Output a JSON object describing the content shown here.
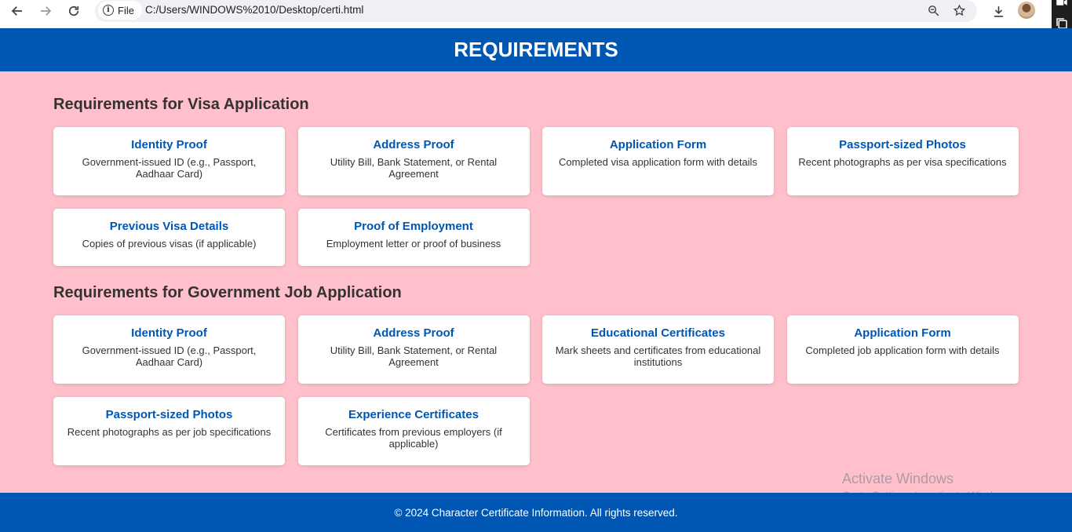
{
  "browser": {
    "url": "C:/Users/WINDOWS%2010/Desktop/certi.html",
    "scheme_label": "File",
    "icons": [
      "back-arrow-icon",
      "forward-arrow-icon",
      "reload-icon",
      "info-icon",
      "zoom-icon",
      "star-icon",
      "download-icon",
      "profile-avatar"
    ]
  },
  "header": {
    "title": "REQUIREMENTS"
  },
  "sections": [
    {
      "title": "Requirements for Visa Application",
      "cards": [
        {
          "title": "Identity Proof",
          "desc": "Government-issued ID (e.g., Passport, Aadhaar Card)"
        },
        {
          "title": "Address Proof",
          "desc": "Utility Bill, Bank Statement, or Rental Agreement"
        },
        {
          "title": "Application Form",
          "desc": "Completed visa application form with details"
        },
        {
          "title": "Passport-sized Photos",
          "desc": "Recent photographs as per visa specifications"
        },
        {
          "title": "Previous Visa Details",
          "desc": "Copies of previous visas (if applicable)"
        },
        {
          "title": "Proof of Employment",
          "desc": "Employment letter or proof of business"
        }
      ]
    },
    {
      "title": "Requirements for Government Job Application",
      "cards": [
        {
          "title": "Identity Proof",
          "desc": "Government-issued ID (e.g., Passport, Aadhaar Card)"
        },
        {
          "title": "Address Proof",
          "desc": "Utility Bill, Bank Statement, or Rental Agreement"
        },
        {
          "title": "Educational Certificates",
          "desc": "Mark sheets and certificates from educational institutions"
        },
        {
          "title": "Application Form",
          "desc": "Completed job application form with details"
        },
        {
          "title": "Passport-sized Photos",
          "desc": "Recent photographs as per job specifications"
        },
        {
          "title": "Experience Certificates",
          "desc": "Certificates from previous employers (if applicable)"
        }
      ]
    }
  ],
  "watermark": {
    "title": "Activate Windows",
    "subtitle": "Go to Settings to activate Windows."
  },
  "footer": {
    "text": "© 2024 Character Certificate Information. All rights reserved."
  },
  "colors": {
    "primary": "#0056b3",
    "background": "#ffc0cb",
    "card": "#ffffff",
    "heading": "#333333"
  }
}
